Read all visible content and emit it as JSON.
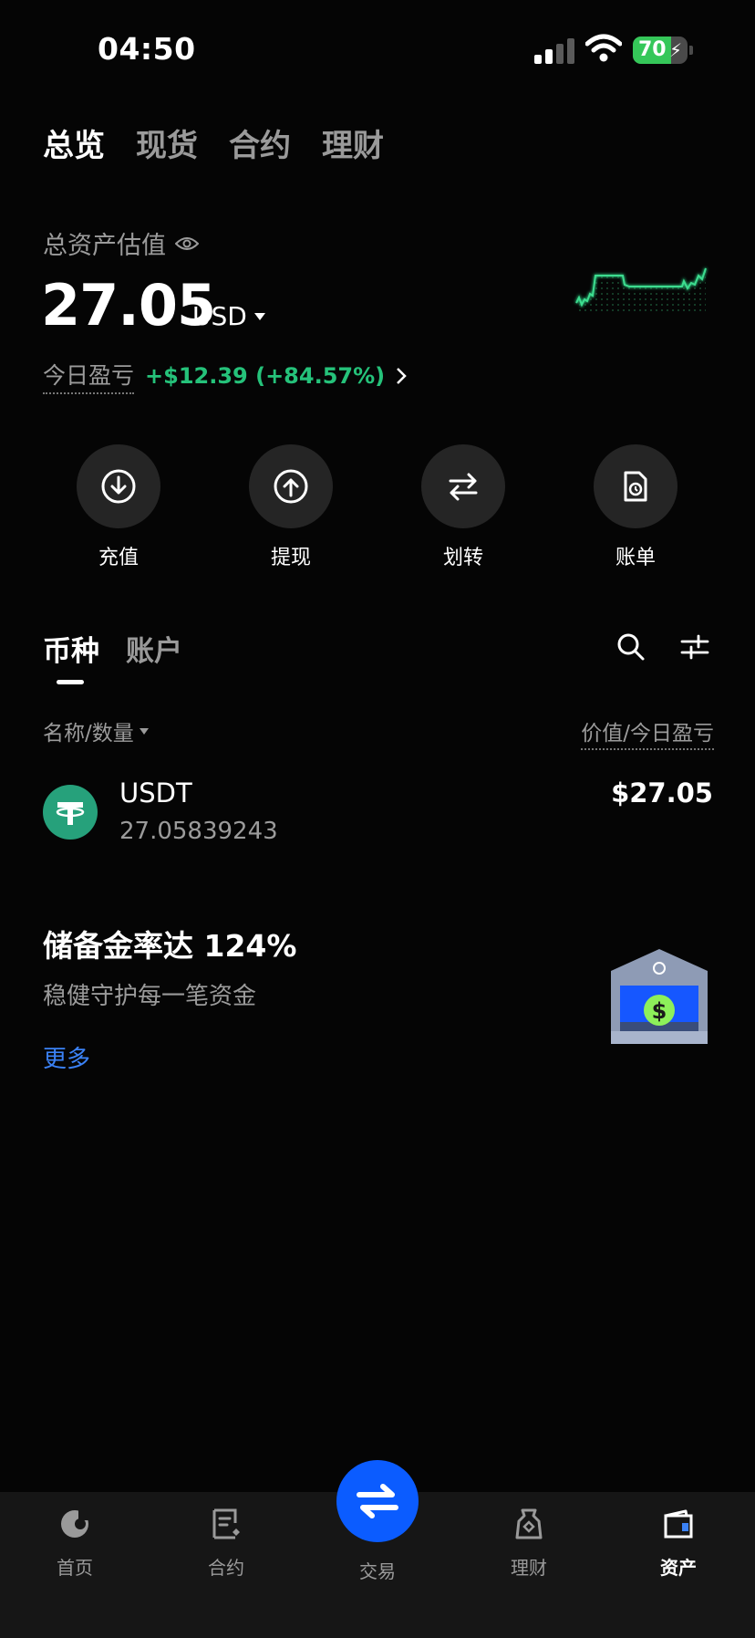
{
  "status_bar": {
    "time": "04:50",
    "battery_level": "70",
    "battery_color": "#35c759"
  },
  "top_tabs": [
    {
      "label": "总览",
      "active": true
    },
    {
      "label": "现货",
      "active": false
    },
    {
      "label": "合约",
      "active": false
    },
    {
      "label": "理财",
      "active": false
    }
  ],
  "overview": {
    "label": "总资产估值",
    "balance": "27.05",
    "currency": "USD",
    "pnl_label": "今日盈亏",
    "pnl_value": "+$12.39 (+84.57%)",
    "accent_color": "#25c27a"
  },
  "actions": [
    {
      "label": "充值",
      "icon": "deposit-icon"
    },
    {
      "label": "提现",
      "icon": "withdraw-icon"
    },
    {
      "label": "划转",
      "icon": "transfer-icon"
    },
    {
      "label": "账单",
      "icon": "bill-icon"
    }
  ],
  "section_tabs": [
    {
      "label": "币种",
      "active": true
    },
    {
      "label": "账户",
      "active": false
    }
  ],
  "list_header": {
    "left": "名称/数量",
    "right": "价值/今日盈亏"
  },
  "assets": [
    {
      "symbol": "USDT",
      "amount": "27.05839243",
      "value": "$27.05",
      "logo_color": "#26a17b"
    }
  ],
  "reserve": {
    "title": "储备金率达 124%",
    "subtitle": "稳健守护每一笔资金",
    "more": "更多",
    "link_color": "#3b82f6"
  },
  "bottom_nav": [
    {
      "label": "首页",
      "icon": "home-icon",
      "active": false
    },
    {
      "label": "合约",
      "icon": "contract-icon",
      "active": false
    },
    {
      "label": "交易",
      "icon": "trade-icon",
      "active": false
    },
    {
      "label": "理财",
      "icon": "finance-icon",
      "active": false
    },
    {
      "label": "资产",
      "icon": "assets-icon",
      "active": true
    }
  ]
}
